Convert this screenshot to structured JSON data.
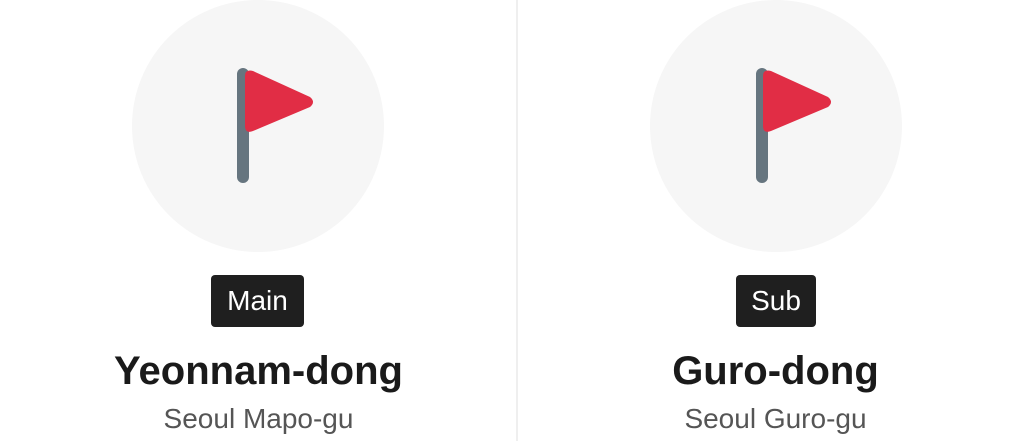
{
  "locations": [
    {
      "badge": "Main",
      "name": "Yeonnam-dong",
      "district": "Seoul Mapo-gu",
      "icon": "red-flag-icon"
    },
    {
      "badge": "Sub",
      "name": "Guro-dong",
      "district": "Seoul Guro-gu",
      "icon": "red-flag-icon"
    }
  ],
  "colors": {
    "flag": "#e12d45",
    "pole": "#66757f",
    "badge_bg": "#1f1f1f",
    "circle_bg": "#f6f6f6"
  }
}
